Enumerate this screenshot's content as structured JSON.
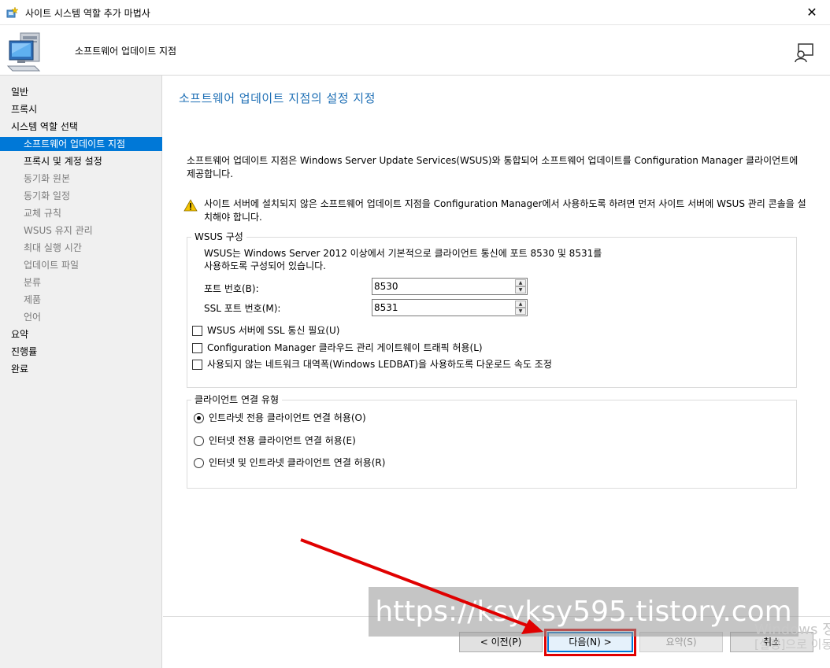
{
  "window": {
    "title": "사이트 시스템 역할 추가 마법사",
    "close_glyph": "✕"
  },
  "header": {
    "subtitle": "소프트웨어 업데이트 지점"
  },
  "nav": {
    "items": [
      {
        "label": "일반"
      },
      {
        "label": "프록시"
      },
      {
        "label": "시스템 역할 선택"
      },
      {
        "label": "소프트웨어 업데이트 지점"
      },
      {
        "label": "프록시 및 계정 설정"
      },
      {
        "label": "동기화 원본"
      },
      {
        "label": "동기화 일정"
      },
      {
        "label": "교체 규칙"
      },
      {
        "label": "WSUS 유지 관리"
      },
      {
        "label": "최대 실행 시간"
      },
      {
        "label": "업데이트 파일"
      },
      {
        "label": "분류"
      },
      {
        "label": "제품"
      },
      {
        "label": "언어"
      },
      {
        "label": "요약"
      },
      {
        "label": "진행률"
      },
      {
        "label": "완료"
      }
    ]
  },
  "main": {
    "heading": "소프트웨어 업데이트 지점의 설정 지정",
    "description": "소프트웨어 업데이트 지점은 Windows Server Update Services(WSUS)와 통합되어 소프트웨어 업데이트를 Configuration Manager 클라이언트에 제공합니다.",
    "warning": "사이트 서버에 설치되지 않은 소프트웨어 업데이트 지점을 Configuration Manager에서 사용하도록 하려면 먼저 사이트 서버에 WSUS 관리 콘솔을 설치해야 합니다."
  },
  "wsus": {
    "legend": "WSUS 구성",
    "info": "WSUS는 Windows Server 2012 이상에서 기본적으로 클라이언트 통신에 포트 8530 및 8531를 사용하도록 구성되어 있습니다.",
    "port_label": "포트 번호(B):",
    "port_value": "8530",
    "ssl_port_label": "SSL 포트 번호(M):",
    "ssl_port_value": "8531",
    "checkboxes": [
      {
        "label": "WSUS 서버에 SSL 통신 필요(U)",
        "checked": false
      },
      {
        "label": "Configuration Manager 클라우드 관리 게이트웨이 트래픽 허용(L)",
        "checked": false
      },
      {
        "label": "사용되지 않는 네트워크 대역폭(Windows LEDBAT)을 사용하도록 다운로드 속도 조정",
        "checked": false
      }
    ]
  },
  "client": {
    "legend": "클라이언트 연결 유형",
    "options": [
      {
        "label": "인트라넷 전용 클라이언트 연결 허용(O)",
        "selected": true
      },
      {
        "label": "인터넷 전용 클라이언트 연결 허용(E)",
        "selected": false
      },
      {
        "label": "인터넷 및 인트라넷 클라이언트 연결 허용(R)",
        "selected": false
      }
    ]
  },
  "buttons": {
    "prev": "< 이전(P)",
    "next": "다음(N) >",
    "summary": "요약(S)",
    "cancel": "취소"
  },
  "overlay": {
    "watermark": "https://ksyksy595.tistory.com",
    "win_line1": "Windows 정",
    "win_line2": "[설정]으로 이동"
  },
  "colors": {
    "accent": "#0078d7",
    "heading": "#1e6fb5",
    "annotation": "#e00000"
  }
}
